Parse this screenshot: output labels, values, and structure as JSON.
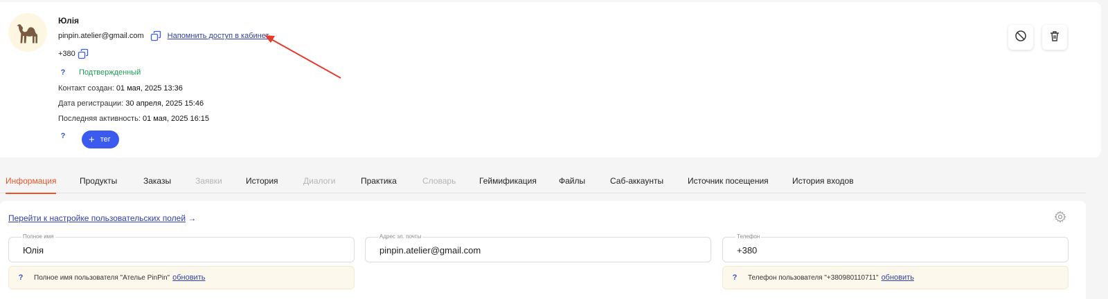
{
  "profile": {
    "name": "Юлія",
    "email": "pinpin.atelier@gmail.com",
    "remind_link": "Напомнить доступ в кабинет",
    "phone": "+380",
    "help_mark": "?",
    "status": "Подтвержденный",
    "status_color": "#1f9d55",
    "created_label": "Контакт создан:",
    "created_value": "01 мая, 2025 13:36",
    "registered_label": "Дата регистрации:",
    "registered_value": "30 апреля, 2025 15:46",
    "activity_label": "Последняя активность:",
    "activity_value": "01 мая, 2025 16:15",
    "tag_button": "тег",
    "tag_plus": "+",
    "avatar_icon": "camel-icon",
    "block_icon": "block-icon",
    "delete_icon": "trash-icon"
  },
  "tabs": [
    {
      "label": "Информация",
      "state": "active"
    },
    {
      "label": "Продукты",
      "state": "normal"
    },
    {
      "label": "Заказы",
      "state": "normal"
    },
    {
      "label": "Заявки",
      "state": "disabled"
    },
    {
      "label": "История",
      "state": "normal"
    },
    {
      "label": "Диалоги",
      "state": "disabled"
    },
    {
      "label": "Практика",
      "state": "normal"
    },
    {
      "label": "Словарь",
      "state": "disabled"
    },
    {
      "label": "Геймификация",
      "state": "normal"
    },
    {
      "label": "Файлы",
      "state": "normal"
    },
    {
      "label": "Саб-аккаунты",
      "state": "normal"
    },
    {
      "label": "Источник посещения",
      "state": "normal"
    },
    {
      "label": "История входов",
      "state": "normal"
    }
  ],
  "info": {
    "fields_link": "Перейти к настройке пользовательских полей",
    "fields_link_arrow": "→",
    "full_name_label": "Полное имя",
    "full_name_value": "Юлія",
    "email_label": "Адрес эл. почты",
    "email_value": "pinpin.atelier@gmail.com",
    "phone_label": "Телефон",
    "phone_value": "+380",
    "name_hint": "Полное имя пользователя \"Ателье PinPin\"",
    "phone_hint": "Телефон пользователя \"+380980110711\"",
    "update_label": "обновить"
  },
  "colors": {
    "accent": "#e8572a",
    "primary": "#3b5bf0",
    "link": "#2d3fa8",
    "annotation_arrow": "#e53b2c"
  }
}
